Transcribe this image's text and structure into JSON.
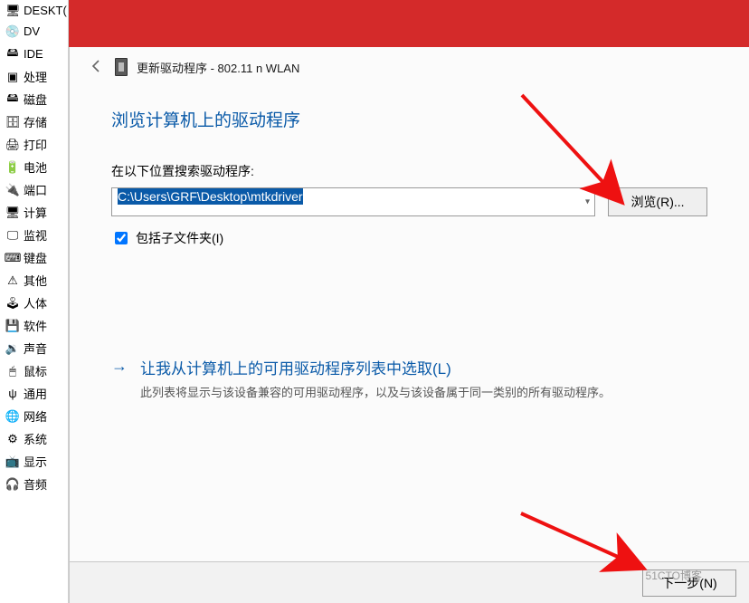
{
  "tree": {
    "root": "DESKT(",
    "items": [
      {
        "icon": "disc",
        "label": "DV"
      },
      {
        "icon": "ide",
        "label": "IDE"
      },
      {
        "icon": "cpu",
        "label": "处理"
      },
      {
        "icon": "disk",
        "label": "磁盘"
      },
      {
        "icon": "storage",
        "label": "存储"
      },
      {
        "icon": "printer",
        "label": "打印"
      },
      {
        "icon": "battery",
        "label": "电池"
      },
      {
        "icon": "port",
        "label": "端口"
      },
      {
        "icon": "pc",
        "label": "计算"
      },
      {
        "icon": "monitor",
        "label": "监视"
      },
      {
        "icon": "keyboard",
        "label": "键盘"
      },
      {
        "icon": "other",
        "label": "其他"
      },
      {
        "icon": "hid",
        "label": "人体"
      },
      {
        "icon": "floppy",
        "label": "软件"
      },
      {
        "icon": "sound",
        "label": "声音"
      },
      {
        "icon": "mouse",
        "label": "鼠标"
      },
      {
        "icon": "usb",
        "label": "通用"
      },
      {
        "icon": "network",
        "label": "网络"
      },
      {
        "icon": "system",
        "label": "系统"
      },
      {
        "icon": "display",
        "label": "显示"
      },
      {
        "icon": "audio",
        "label": "音频"
      }
    ]
  },
  "dialog": {
    "header": "更新驱动程序 - 802.11 n WLAN",
    "title": "浏览计算机上的驱动程序",
    "search_label": "在以下位置搜索驱动程序:",
    "path_value": "C:\\Users\\GRF\\Desktop\\mtkdriver",
    "browse_btn": "浏览(R)...",
    "include_sub": "包括子文件夹(I)",
    "include_sub_checked": true,
    "link_title": "让我从计算机上的可用驱动程序列表中选取(L)",
    "link_desc": "此列表将显示与该设备兼容的可用驱动程序，以及与该设备属于同一类别的所有驱动程序。",
    "next_btn": "下一步(N)"
  },
  "watermark": "51CTO博客"
}
